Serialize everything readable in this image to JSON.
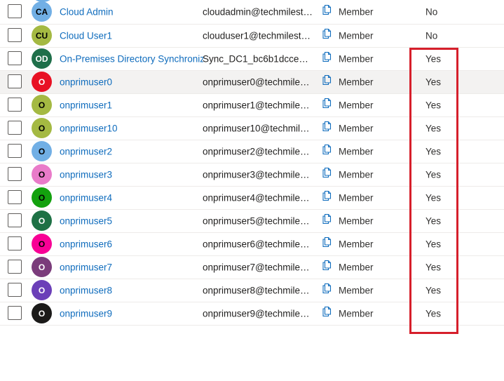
{
  "colors": {
    "link": "#0f6cbd",
    "highlight_box": "#d61f2b",
    "row_hover": "#f3f2f1"
  },
  "users": [
    {
      "initials": "CA",
      "name": "Cloud Admin",
      "upn": "cloudadmin@techmilesto...",
      "type": "Member",
      "onprem_sync": "No",
      "avatar_color": "#71afe5"
    },
    {
      "initials": "CU",
      "name": "Cloud User1",
      "upn": "clouduser1@techmileston...",
      "type": "Member",
      "onprem_sync": "No",
      "avatar_color": "#a4b942"
    },
    {
      "initials": "OD",
      "name": "On-Premises Directory Synchronizat",
      "upn": "Sync_DC1_bc6b1dcced58...",
      "type": "Member",
      "onprem_sync": "Yes",
      "avatar_color": "#1f6f4a"
    },
    {
      "initials": "O",
      "name": "onprimuser0",
      "upn": "onprimuser0@techmilest...",
      "type": "Member",
      "onprem_sync": "Yes",
      "avatar_color": "#e81123"
    },
    {
      "initials": "O",
      "name": "onprimuser1",
      "upn": "onprimuser1@techmilest...",
      "type": "Member",
      "onprem_sync": "Yes",
      "avatar_color": "#a4b942"
    },
    {
      "initials": "O",
      "name": "onprimuser10",
      "upn": "onprimuser10@techmiles...",
      "type": "Member",
      "onprem_sync": "Yes",
      "avatar_color": "#a4b942"
    },
    {
      "initials": "O",
      "name": "onprimuser2",
      "upn": "onprimuser2@techmilest...",
      "type": "Member",
      "onprem_sync": "Yes",
      "avatar_color": "#71afe5"
    },
    {
      "initials": "O",
      "name": "onprimuser3",
      "upn": "onprimuser3@techmilest...",
      "type": "Member",
      "onprem_sync": "Yes",
      "avatar_color": "#e97bc9"
    },
    {
      "initials": "O",
      "name": "onprimuser4",
      "upn": "onprimuser4@techmilest...",
      "type": "Member",
      "onprem_sync": "Yes",
      "avatar_color": "#13a10e"
    },
    {
      "initials": "O",
      "name": "onprimuser5",
      "upn": "onprimuser5@techmilest...",
      "type": "Member",
      "onprem_sync": "Yes",
      "avatar_color": "#1e7145"
    },
    {
      "initials": "O",
      "name": "onprimuser6",
      "upn": "onprimuser6@techmilest...",
      "type": "Member",
      "onprem_sync": "Yes",
      "avatar_color": "#f80095"
    },
    {
      "initials": "O",
      "name": "onprimuser7",
      "upn": "onprimuser7@techmilest...",
      "type": "Member",
      "onprem_sync": "Yes",
      "avatar_color": "#7b3c7b"
    },
    {
      "initials": "O",
      "name": "onprimuser8",
      "upn": "onprimuser8@techmilest...",
      "type": "Member",
      "onprem_sync": "Yes",
      "avatar_color": "#6b3fb8"
    },
    {
      "initials": "O",
      "name": "onprimuser9",
      "upn": "onprimuser9@techmilest...",
      "type": "Member",
      "onprem_sync": "Yes",
      "avatar_color": "#1b1a19"
    }
  ],
  "icons": {
    "copy": "copy-icon"
  }
}
